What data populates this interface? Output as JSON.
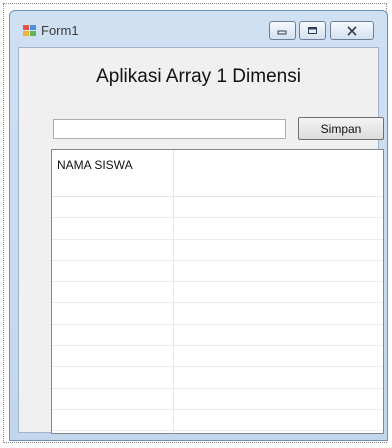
{
  "window": {
    "title": "Form1"
  },
  "form": {
    "heading": "Aplikasi Array 1 Dimensi",
    "input_value": "",
    "save_label": "Simpan"
  },
  "list": {
    "column_header": "NAMA SISWA",
    "rows": [
      "",
      "",
      "",
      "",
      "",
      "",
      "",
      "",
      "",
      "",
      "",
      ""
    ]
  }
}
